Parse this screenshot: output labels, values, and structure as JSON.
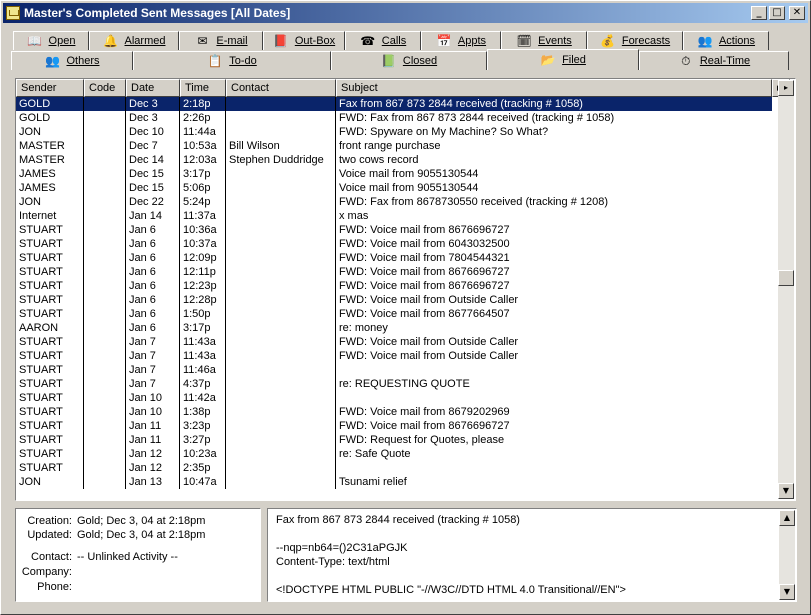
{
  "window": {
    "title": "Master's Completed Sent Messages  [All Dates]",
    "minimize": "_",
    "maximize": "□",
    "close": "✕"
  },
  "tabs_row1": [
    {
      "label": "Open",
      "icon": "book-icon",
      "glyph": "📖"
    },
    {
      "label": "Alarmed",
      "icon": "bell-icon",
      "glyph": "🔔"
    },
    {
      "label": "E-mail",
      "icon": "envelope-icon",
      "glyph": "✉"
    },
    {
      "label": "Out-Box",
      "icon": "outbox-icon",
      "glyph": "📕"
    },
    {
      "label": "Calls",
      "icon": "phone-icon",
      "glyph": "☎"
    },
    {
      "label": "Appts",
      "icon": "calendar-icon",
      "glyph": "📅"
    },
    {
      "label": "Events",
      "icon": "events-icon",
      "glyph": "🗓"
    },
    {
      "label": "Forecasts",
      "icon": "money-icon",
      "glyph": "💰"
    },
    {
      "label": "Actions",
      "icon": "actions-icon",
      "glyph": "👥"
    }
  ],
  "tabs_row2": [
    {
      "label": "Others",
      "icon": "people-icon",
      "glyph": "👥"
    },
    {
      "label": "To-do",
      "icon": "todo-icon",
      "glyph": "📋"
    },
    {
      "label": "Closed",
      "icon": "closed-icon",
      "glyph": "📗"
    },
    {
      "label": "Filed",
      "icon": "folder-icon",
      "glyph": "📂"
    },
    {
      "label": "Real-Time",
      "icon": "clock-icon",
      "glyph": "⏱"
    }
  ],
  "columns": [
    "Sender",
    "Code",
    "Date",
    "Time",
    "Contact",
    "Subject"
  ],
  "scroll_right": "▸",
  "rows": [
    {
      "sender": "GOLD",
      "code": "",
      "date": "Dec 3",
      "time": "2:18p",
      "contact": "",
      "subject": "Fax from 867 873 2844 received (tracking # 1058)",
      "selected": true
    },
    {
      "sender": "GOLD",
      "code": "",
      "date": "Dec 3",
      "time": "2:26p",
      "contact": "",
      "subject": "FWD: Fax from 867 873 2844 received (tracking # 1058)"
    },
    {
      "sender": "JON",
      "code": "",
      "date": "Dec 10",
      "time": "11:44a",
      "contact": "",
      "subject": "FWD: Spyware on My Machine? So What?"
    },
    {
      "sender": "MASTER",
      "code": "",
      "date": "Dec 7",
      "time": "10:53a",
      "contact": "Bill Wilson",
      "subject": "front range purchase"
    },
    {
      "sender": "MASTER",
      "code": "",
      "date": "Dec 14",
      "time": "12:03a",
      "contact": "Stephen Duddridge",
      "subject": "two cows record"
    },
    {
      "sender": "JAMES",
      "code": "",
      "date": "Dec 15",
      "time": "3:17p",
      "contact": "",
      "subject": "Voice mail from 9055130544"
    },
    {
      "sender": "JAMES",
      "code": "",
      "date": "Dec 15",
      "time": "5:06p",
      "contact": "",
      "subject": "Voice mail from 9055130544"
    },
    {
      "sender": "JON",
      "code": "",
      "date": "Dec 22",
      "time": "5:24p",
      "contact": "",
      "subject": "FWD: Fax from 8678730550 received (tracking # 1208)"
    },
    {
      "sender": "Internet",
      "code": "",
      "date": "Jan 14",
      "time": "11:37a",
      "contact": "",
      "subject": "x mas"
    },
    {
      "sender": "STUART",
      "code": "",
      "date": "Jan 6",
      "time": "10:36a",
      "contact": "",
      "subject": "FWD: Voice mail from 8676696727"
    },
    {
      "sender": "STUART",
      "code": "",
      "date": "Jan 6",
      "time": "10:37a",
      "contact": "",
      "subject": "FWD: Voice mail from 6043032500"
    },
    {
      "sender": "STUART",
      "code": "",
      "date": "Jan 6",
      "time": "12:09p",
      "contact": "",
      "subject": "FWD: Voice mail from 7804544321"
    },
    {
      "sender": "STUART",
      "code": "",
      "date": "Jan 6",
      "time": "12:11p",
      "contact": "",
      "subject": "FWD: Voice mail from 8676696727"
    },
    {
      "sender": "STUART",
      "code": "",
      "date": "Jan 6",
      "time": "12:23p",
      "contact": "",
      "subject": "FWD: Voice mail from 8676696727"
    },
    {
      "sender": "STUART",
      "code": "",
      "date": "Jan 6",
      "time": "12:28p",
      "contact": "",
      "subject": "FWD: Voice mail from Outside Caller"
    },
    {
      "sender": "STUART",
      "code": "",
      "date": "Jan 6",
      "time": "1:50p",
      "contact": "",
      "subject": "FWD: Voice mail from 8677664507"
    },
    {
      "sender": "AARON",
      "code": "",
      "date": "Jan 6",
      "time": "3:17p",
      "contact": "",
      "subject": "re: money"
    },
    {
      "sender": "STUART",
      "code": "",
      "date": "Jan 7",
      "time": "11:43a",
      "contact": "",
      "subject": "FWD: Voice mail from Outside Caller"
    },
    {
      "sender": "STUART",
      "code": "",
      "date": "Jan 7",
      "time": "11:43a",
      "contact": "",
      "subject": "FWD: Voice mail from Outside Caller"
    },
    {
      "sender": "STUART",
      "code": "",
      "date": "Jan 7",
      "time": "11:46a",
      "contact": "",
      "subject": ""
    },
    {
      "sender": "STUART",
      "code": "",
      "date": "Jan 7",
      "time": "4:37p",
      "contact": "",
      "subject": "re: REQUESTING  QUOTE"
    },
    {
      "sender": "STUART",
      "code": "",
      "date": "Jan 10",
      "time": "11:42a",
      "contact": "",
      "subject": ""
    },
    {
      "sender": "STUART",
      "code": "",
      "date": "Jan 10",
      "time": "1:38p",
      "contact": "",
      "subject": "FWD: Voice mail from 8679202969"
    },
    {
      "sender": "STUART",
      "code": "",
      "date": "Jan 11",
      "time": "3:23p",
      "contact": "",
      "subject": "FWD: Voice mail from 8676696727"
    },
    {
      "sender": "STUART",
      "code": "",
      "date": "Jan 11",
      "time": "3:27p",
      "contact": "",
      "subject": "FWD: Request for Quotes, please"
    },
    {
      "sender": "STUART",
      "code": "",
      "date": "Jan 12",
      "time": "10:23a",
      "contact": "",
      "subject": "re: Safe Quote"
    },
    {
      "sender": "STUART",
      "code": "",
      "date": "Jan 12",
      "time": "2:35p",
      "contact": "",
      "subject": ""
    },
    {
      "sender": "JON",
      "code": "",
      "date": "Jan 13",
      "time": "10:47a",
      "contact": "",
      "subject": "Tsunami relief"
    }
  ],
  "scrollbar": {
    "up": "▲",
    "down": "▼",
    "thumb_position": 0.47
  },
  "details": {
    "creation_label": "Creation:",
    "creation_value": "Gold; Dec 3, 04 at 2:18pm",
    "updated_label": "Updated:",
    "updated_value": "Gold; Dec 3, 04 at 2:18pm",
    "contact_label": "Contact:",
    "contact_value": "-- Unlinked Activity --",
    "company_label": "Company:",
    "company_value": "",
    "phone_label": "Phone:",
    "phone_value": ""
  },
  "message_body": "Fax from 867 873 2844 received (tracking # 1058)\n\n--nqp=nb64=()2C31aPGJK\nContent-Type: text/html\n\n<!DOCTYPE HTML PUBLIC \"-//W3C//DTD HTML 4.0 Transitional//EN\">"
}
